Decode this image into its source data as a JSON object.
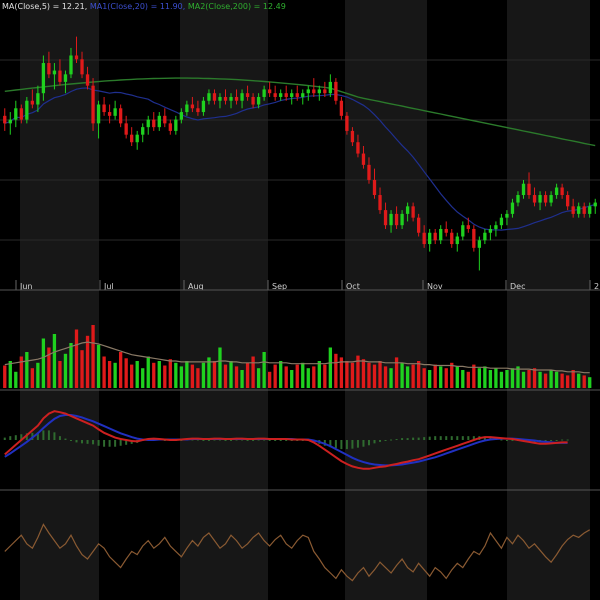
{
  "legend": {
    "ma_label": "MA(Close,5) = 12.21, ",
    "ma1_label": "MA1(Close,20) = 11.90, ",
    "ma2_label": "MA2(Close,200) = 12.49"
  },
  "colors": {
    "background": "#000000",
    "panel_alt": "#171717",
    "grid": "#2a2a2a",
    "up": "#1fd11f",
    "down": "#e01a1a",
    "ma20": "#1f2f8f",
    "ma200": "#2b7a2b",
    "volume_ma": "#8a7a66",
    "macd_line": "#cc2020",
    "macd_signal": "#2030c0",
    "macd_hist": "#2f6b2f",
    "indicator": "#8a5a32",
    "legend_text": "#e0e0e0"
  },
  "chart_data": {
    "type": "candlestick",
    "months": [
      "Jun",
      "Jul",
      "Aug",
      "Sep",
      "Oct",
      "Nov",
      "Dec",
      "2"
    ],
    "price_range": [
      9.5,
      16.5
    ],
    "grid": true,
    "candles": [
      {
        "o": 13.8,
        "h": 14.0,
        "l": 13.4,
        "c": 13.6
      },
      {
        "o": 13.6,
        "h": 13.9,
        "l": 13.3,
        "c": 13.7
      },
      {
        "o": 13.7,
        "h": 14.2,
        "l": 13.5,
        "c": 14.0
      },
      {
        "o": 14.0,
        "h": 14.1,
        "l": 13.6,
        "c": 13.7
      },
      {
        "o": 13.7,
        "h": 14.3,
        "l": 13.6,
        "c": 14.2
      },
      {
        "o": 14.2,
        "h": 14.5,
        "l": 14.0,
        "c": 14.1
      },
      {
        "o": 14.1,
        "h": 14.6,
        "l": 13.9,
        "c": 14.4
      },
      {
        "o": 14.4,
        "h": 15.4,
        "l": 14.2,
        "c": 15.2
      },
      {
        "o": 15.2,
        "h": 15.5,
        "l": 14.8,
        "c": 14.9
      },
      {
        "o": 14.9,
        "h": 15.2,
        "l": 14.5,
        "c": 15.0
      },
      {
        "o": 15.0,
        "h": 15.3,
        "l": 14.6,
        "c": 14.7
      },
      {
        "o": 14.7,
        "h": 15.0,
        "l": 14.4,
        "c": 14.9
      },
      {
        "o": 14.9,
        "h": 15.6,
        "l": 14.8,
        "c": 15.4
      },
      {
        "o": 15.4,
        "h": 15.9,
        "l": 15.2,
        "c": 15.3
      },
      {
        "o": 15.3,
        "h": 15.5,
        "l": 14.8,
        "c": 14.9
      },
      {
        "o": 14.9,
        "h": 15.1,
        "l": 14.5,
        "c": 14.6
      },
      {
        "o": 14.6,
        "h": 14.8,
        "l": 13.4,
        "c": 13.6
      },
      {
        "o": 13.6,
        "h": 14.2,
        "l": 13.2,
        "c": 14.1
      },
      {
        "o": 14.1,
        "h": 14.3,
        "l": 13.8,
        "c": 13.9
      },
      {
        "o": 13.9,
        "h": 14.1,
        "l": 13.6,
        "c": 13.8
      },
      {
        "o": 13.8,
        "h": 14.2,
        "l": 13.7,
        "c": 14.0
      },
      {
        "o": 14.0,
        "h": 14.1,
        "l": 13.5,
        "c": 13.6
      },
      {
        "o": 13.6,
        "h": 13.8,
        "l": 13.2,
        "c": 13.3
      },
      {
        "o": 13.3,
        "h": 13.5,
        "l": 13.0,
        "c": 13.1
      },
      {
        "o": 13.1,
        "h": 13.4,
        "l": 12.9,
        "c": 13.3
      },
      {
        "o": 13.3,
        "h": 13.6,
        "l": 13.1,
        "c": 13.5
      },
      {
        "o": 13.5,
        "h": 13.8,
        "l": 13.3,
        "c": 13.7
      },
      {
        "o": 13.7,
        "h": 13.9,
        "l": 13.4,
        "c": 13.5
      },
      {
        "o": 13.5,
        "h": 13.9,
        "l": 13.4,
        "c": 13.8
      },
      {
        "o": 13.8,
        "h": 14.0,
        "l": 13.5,
        "c": 13.6
      },
      {
        "o": 13.6,
        "h": 13.7,
        "l": 13.3,
        "c": 13.4
      },
      {
        "o": 13.4,
        "h": 13.8,
        "l": 13.3,
        "c": 13.7
      },
      {
        "o": 13.7,
        "h": 14.0,
        "l": 13.6,
        "c": 13.9
      },
      {
        "o": 13.9,
        "h": 14.2,
        "l": 13.8,
        "c": 14.1
      },
      {
        "o": 14.1,
        "h": 14.3,
        "l": 13.9,
        "c": 14.0
      },
      {
        "o": 14.0,
        "h": 14.2,
        "l": 13.8,
        "c": 13.9
      },
      {
        "o": 13.9,
        "h": 14.3,
        "l": 13.8,
        "c": 14.2
      },
      {
        "o": 14.2,
        "h": 14.5,
        "l": 14.1,
        "c": 14.4
      },
      {
        "o": 14.4,
        "h": 14.5,
        "l": 14.1,
        "c": 14.2
      },
      {
        "o": 14.2,
        "h": 14.4,
        "l": 14.0,
        "c": 14.3
      },
      {
        "o": 14.3,
        "h": 14.5,
        "l": 14.1,
        "c": 14.2
      },
      {
        "o": 14.2,
        "h": 14.4,
        "l": 14.0,
        "c": 14.3
      },
      {
        "o": 14.3,
        "h": 14.5,
        "l": 14.1,
        "c": 14.2
      },
      {
        "o": 14.2,
        "h": 14.5,
        "l": 14.0,
        "c": 14.4
      },
      {
        "o": 14.4,
        "h": 14.6,
        "l": 14.2,
        "c": 14.3
      },
      {
        "o": 14.3,
        "h": 14.4,
        "l": 14.0,
        "c": 14.1
      },
      {
        "o": 14.1,
        "h": 14.4,
        "l": 14.0,
        "c": 14.3
      },
      {
        "o": 14.3,
        "h": 14.6,
        "l": 14.2,
        "c": 14.5
      },
      {
        "o": 14.5,
        "h": 14.7,
        "l": 14.3,
        "c": 14.4
      },
      {
        "o": 14.4,
        "h": 14.6,
        "l": 14.2,
        "c": 14.3
      },
      {
        "o": 14.3,
        "h": 14.5,
        "l": 14.2,
        "c": 14.4
      },
      {
        "o": 14.4,
        "h": 14.6,
        "l": 14.2,
        "c": 14.3
      },
      {
        "o": 14.3,
        "h": 14.5,
        "l": 14.1,
        "c": 14.4
      },
      {
        "o": 14.4,
        "h": 14.6,
        "l": 14.2,
        "c": 14.3
      },
      {
        "o": 14.3,
        "h": 14.5,
        "l": 14.1,
        "c": 14.4
      },
      {
        "o": 14.4,
        "h": 14.6,
        "l": 14.2,
        "c": 14.5
      },
      {
        "o": 14.5,
        "h": 14.8,
        "l": 14.3,
        "c": 14.4
      },
      {
        "o": 14.4,
        "h": 14.6,
        "l": 14.2,
        "c": 14.5
      },
      {
        "o": 14.5,
        "h": 14.7,
        "l": 14.3,
        "c": 14.4
      },
      {
        "o": 14.4,
        "h": 14.9,
        "l": 14.3,
        "c": 14.7
      },
      {
        "o": 14.7,
        "h": 14.8,
        "l": 14.1,
        "c": 14.2
      },
      {
        "o": 14.2,
        "h": 14.3,
        "l": 13.7,
        "c": 13.8
      },
      {
        "o": 13.8,
        "h": 13.9,
        "l": 13.3,
        "c": 13.4
      },
      {
        "o": 13.4,
        "h": 13.5,
        "l": 13.0,
        "c": 13.1
      },
      {
        "o": 13.1,
        "h": 13.3,
        "l": 12.7,
        "c": 12.8
      },
      {
        "o": 12.8,
        "h": 13.0,
        "l": 12.4,
        "c": 12.5
      },
      {
        "o": 12.5,
        "h": 12.7,
        "l": 12.0,
        "c": 12.1
      },
      {
        "o": 12.1,
        "h": 12.4,
        "l": 11.6,
        "c": 11.7
      },
      {
        "o": 11.7,
        "h": 11.9,
        "l": 11.2,
        "c": 11.3
      },
      {
        "o": 11.3,
        "h": 11.5,
        "l": 10.8,
        "c": 10.9
      },
      {
        "o": 10.9,
        "h": 11.3,
        "l": 10.7,
        "c": 11.2
      },
      {
        "o": 11.2,
        "h": 11.4,
        "l": 10.8,
        "c": 10.9
      },
      {
        "o": 10.9,
        "h": 11.3,
        "l": 10.8,
        "c": 11.2
      },
      {
        "o": 11.2,
        "h": 11.5,
        "l": 11.0,
        "c": 11.4
      },
      {
        "o": 11.4,
        "h": 11.5,
        "l": 11.0,
        "c": 11.1
      },
      {
        "o": 11.1,
        "h": 11.2,
        "l": 10.6,
        "c": 10.7
      },
      {
        "o": 10.7,
        "h": 10.9,
        "l": 10.3,
        "c": 10.4
      },
      {
        "o": 10.4,
        "h": 10.8,
        "l": 10.2,
        "c": 10.7
      },
      {
        "o": 10.7,
        "h": 10.8,
        "l": 10.4,
        "c": 10.5
      },
      {
        "o": 10.5,
        "h": 10.9,
        "l": 10.4,
        "c": 10.8
      },
      {
        "o": 10.8,
        "h": 11.0,
        "l": 10.6,
        "c": 10.7
      },
      {
        "o": 10.7,
        "h": 10.8,
        "l": 10.3,
        "c": 10.4
      },
      {
        "o": 10.4,
        "h": 10.7,
        "l": 10.2,
        "c": 10.6
      },
      {
        "o": 10.6,
        "h": 11.0,
        "l": 10.5,
        "c": 10.9
      },
      {
        "o": 10.9,
        "h": 11.1,
        "l": 10.7,
        "c": 10.8
      },
      {
        "o": 10.8,
        "h": 10.9,
        "l": 10.2,
        "c": 10.3
      },
      {
        "o": 10.3,
        "h": 10.6,
        "l": 9.7,
        "c": 10.5
      },
      {
        "o": 10.5,
        "h": 10.8,
        "l": 10.4,
        "c": 10.7
      },
      {
        "o": 10.7,
        "h": 10.9,
        "l": 10.5,
        "c": 10.8
      },
      {
        "o": 10.8,
        "h": 11.0,
        "l": 10.6,
        "c": 10.9
      },
      {
        "o": 10.9,
        "h": 11.2,
        "l": 10.8,
        "c": 11.1
      },
      {
        "o": 11.1,
        "h": 11.3,
        "l": 10.9,
        "c": 11.2
      },
      {
        "o": 11.2,
        "h": 11.6,
        "l": 11.1,
        "c": 11.5
      },
      {
        "o": 11.5,
        "h": 11.8,
        "l": 11.4,
        "c": 11.7
      },
      {
        "o": 11.7,
        "h": 12.1,
        "l": 11.6,
        "c": 12.0
      },
      {
        "o": 12.0,
        "h": 12.3,
        "l": 11.6,
        "c": 11.7
      },
      {
        "o": 11.7,
        "h": 11.9,
        "l": 11.4,
        "c": 11.5
      },
      {
        "o": 11.5,
        "h": 11.8,
        "l": 11.3,
        "c": 11.7
      },
      {
        "o": 11.7,
        "h": 11.8,
        "l": 11.4,
        "c": 11.5
      },
      {
        "o": 11.5,
        "h": 11.8,
        "l": 11.4,
        "c": 11.7
      },
      {
        "o": 11.7,
        "h": 12.0,
        "l": 11.6,
        "c": 11.9
      },
      {
        "o": 11.9,
        "h": 12.0,
        "l": 11.6,
        "c": 11.7
      },
      {
        "o": 11.7,
        "h": 11.8,
        "l": 11.3,
        "c": 11.4
      },
      {
        "o": 11.4,
        "h": 11.6,
        "l": 11.1,
        "c": 11.2
      },
      {
        "o": 11.2,
        "h": 11.5,
        "l": 11.1,
        "c": 11.4
      },
      {
        "o": 11.4,
        "h": 11.5,
        "l": 11.1,
        "c": 11.2
      },
      {
        "o": 11.2,
        "h": 11.5,
        "l": 11.1,
        "c": 11.4
      },
      {
        "o": 11.4,
        "h": 11.6,
        "l": 11.2,
        "c": 11.5
      }
    ],
    "volume_range": [
      0,
      100
    ],
    "volume": [
      25,
      30,
      18,
      35,
      40,
      22,
      28,
      55,
      45,
      60,
      30,
      38,
      50,
      65,
      42,
      58,
      70,
      48,
      35,
      30,
      28,
      40,
      33,
      26,
      30,
      22,
      35,
      28,
      30,
      25,
      32,
      28,
      24,
      30,
      26,
      22,
      28,
      34,
      30,
      45,
      26,
      30,
      24,
      20,
      28,
      35,
      22,
      40,
      18,
      26,
      30,
      24,
      20,
      26,
      28,
      22,
      24,
      30,
      26,
      45,
      38,
      34,
      30,
      28,
      36,
      32,
      28,
      26,
      30,
      24,
      22,
      34,
      28,
      24,
      26,
      30,
      22,
      20,
      26,
      24,
      22,
      28,
      24,
      20,
      18,
      26,
      22,
      24,
      20,
      22,
      18,
      20,
      22,
      24,
      18,
      20,
      22,
      18,
      16,
      20,
      18,
      16,
      14,
      20,
      16,
      14,
      12
    ],
    "volume_ma": [
      26,
      27,
      28,
      29,
      30,
      31,
      32,
      34,
      37,
      40,
      42,
      44,
      46,
      48,
      50,
      51,
      50,
      49,
      47,
      45,
      43,
      41,
      39,
      37,
      36,
      35,
      34,
      33,
      32,
      31,
      30,
      30,
      29,
      29,
      29,
      29,
      29,
      29,
      29,
      30,
      30,
      29,
      29,
      28,
      28,
      28,
      28,
      29,
      28,
      28,
      28,
      28,
      27,
      27,
      27,
      27,
      27,
      27,
      27,
      28,
      28,
      29,
      29,
      29,
      30,
      30,
      29,
      29,
      29,
      28,
      28,
      28,
      28,
      27,
      27,
      27,
      26,
      26,
      25,
      25,
      25,
      25,
      24,
      24,
      23,
      23,
      23,
      23,
      22,
      22,
      22,
      22,
      21,
      21,
      21,
      21,
      20,
      20,
      20,
      20,
      19,
      19,
      18,
      18,
      18,
      17,
      17
    ],
    "macd_range": [
      -1.0,
      1.0
    ],
    "macd": [
      -0.3,
      -0.2,
      -0.1,
      0.0,
      0.1,
      0.2,
      0.3,
      0.45,
      0.55,
      0.6,
      0.58,
      0.55,
      0.5,
      0.45,
      0.4,
      0.35,
      0.3,
      0.22,
      0.15,
      0.1,
      0.05,
      0.02,
      0.0,
      -0.02,
      -0.03,
      0.0,
      0.02,
      0.03,
      0.02,
      0.01,
      0.0,
      0.0,
      0.01,
      0.02,
      0.03,
      0.03,
      0.02,
      0.02,
      0.03,
      0.03,
      0.02,
      0.02,
      0.03,
      0.03,
      0.02,
      0.02,
      0.03,
      0.03,
      0.02,
      0.02,
      0.02,
      0.02,
      0.01,
      0.01,
      0.01,
      0.0,
      -0.05,
      -0.12,
      -0.2,
      -0.28,
      -0.36,
      -0.44,
      -0.5,
      -0.55,
      -0.58,
      -0.6,
      -0.6,
      -0.58,
      -0.56,
      -0.55,
      -0.52,
      -0.5,
      -0.47,
      -0.45,
      -0.42,
      -0.4,
      -0.36,
      -0.32,
      -0.28,
      -0.24,
      -0.2,
      -0.16,
      -0.12,
      -0.08,
      -0.04,
      0.0,
      0.04,
      0.06,
      0.06,
      0.05,
      0.04,
      0.03,
      0.02,
      0.0,
      -0.02,
      -0.04,
      -0.06,
      -0.08,
      -0.08,
      -0.07,
      -0.06,
      -0.05,
      -0.05
    ],
    "macd_signal": [
      -0.35,
      -0.28,
      -0.2,
      -0.12,
      -0.04,
      0.05,
      0.14,
      0.25,
      0.35,
      0.44,
      0.5,
      0.52,
      0.52,
      0.5,
      0.47,
      0.43,
      0.39,
      0.34,
      0.29,
      0.24,
      0.19,
      0.14,
      0.1,
      0.06,
      0.03,
      0.01,
      0.0,
      0.0,
      0.01,
      0.01,
      0.01,
      0.01,
      0.01,
      0.01,
      0.02,
      0.02,
      0.02,
      0.02,
      0.02,
      0.02,
      0.02,
      0.02,
      0.02,
      0.02,
      0.02,
      0.02,
      0.02,
      0.02,
      0.02,
      0.02,
      0.02,
      0.02,
      0.02,
      0.01,
      0.01,
      0.01,
      -0.01,
      -0.04,
      -0.08,
      -0.13,
      -0.19,
      -0.25,
      -0.31,
      -0.37,
      -0.42,
      -0.46,
      -0.49,
      -0.51,
      -0.52,
      -0.53,
      -0.53,
      -0.52,
      -0.51,
      -0.49,
      -0.47,
      -0.45,
      -0.42,
      -0.39,
      -0.36,
      -0.32,
      -0.28,
      -0.24,
      -0.2,
      -0.16,
      -0.12,
      -0.08,
      -0.04,
      -0.01,
      0.01,
      0.02,
      0.03,
      0.03,
      0.03,
      0.02,
      0.01,
      0.0,
      -0.01,
      -0.03,
      -0.04,
      -0.05,
      -0.06,
      -0.06,
      -0.06
    ],
    "indicator_range": [
      0,
      100
    ],
    "indicator": [
      45,
      50,
      55,
      60,
      52,
      48,
      58,
      70,
      62,
      55,
      48,
      52,
      60,
      50,
      42,
      38,
      45,
      52,
      48,
      40,
      35,
      30,
      38,
      45,
      42,
      50,
      55,
      48,
      52,
      58,
      50,
      45,
      40,
      48,
      55,
      50,
      58,
      62,
      55,
      48,
      52,
      60,
      55,
      48,
      52,
      58,
      62,
      55,
      50,
      56,
      60,
      52,
      48,
      55,
      60,
      58,
      45,
      38,
      30,
      25,
      20,
      28,
      22,
      18,
      25,
      30,
      22,
      28,
      35,
      30,
      25,
      32,
      38,
      30,
      26,
      34,
      28,
      22,
      30,
      26,
      20,
      28,
      34,
      30,
      38,
      45,
      42,
      50,
      62,
      55,
      48,
      58,
      52,
      60,
      55,
      48,
      52,
      46,
      40,
      35,
      42,
      50,
      56,
      60,
      58,
      62,
      65
    ]
  }
}
